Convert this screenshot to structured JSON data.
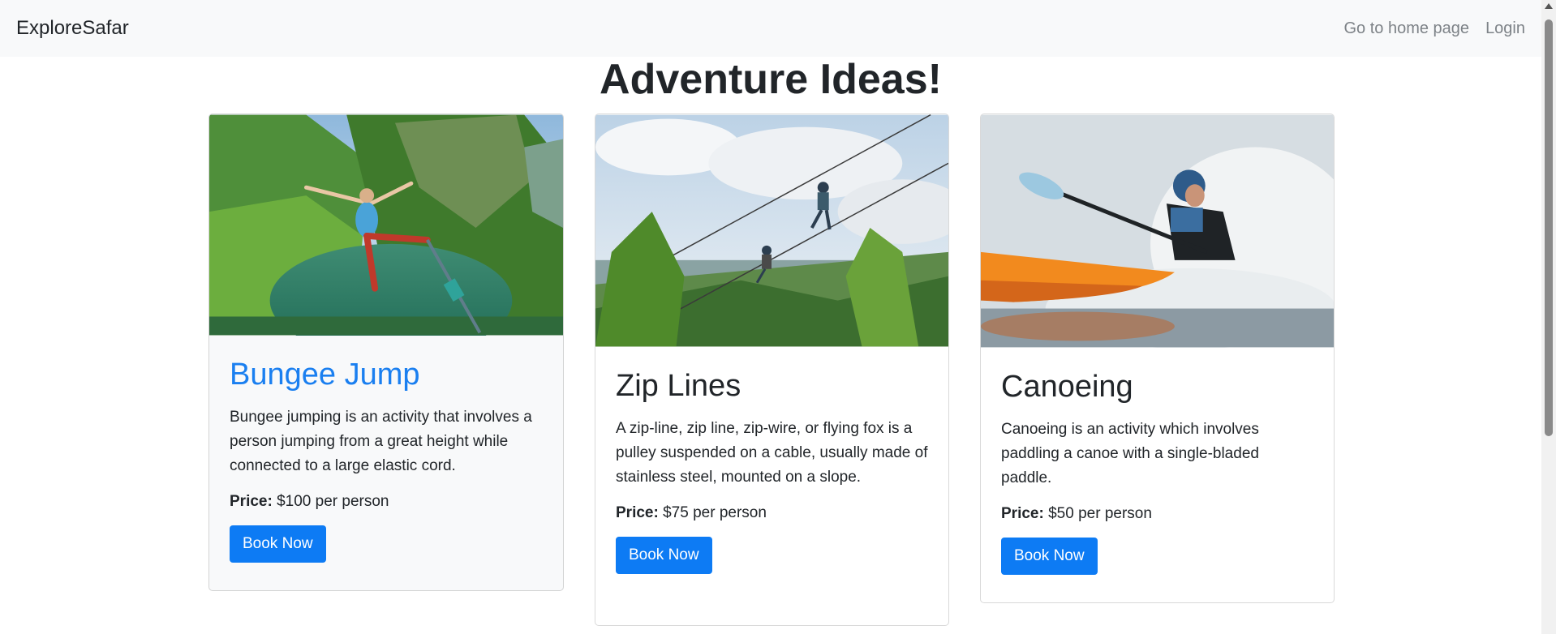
{
  "navbar": {
    "brand": "ExploreSafar",
    "links": [
      "Go to home page",
      "Login"
    ]
  },
  "page": {
    "title": "Adventure Ideas!"
  },
  "cards": [
    {
      "title": "Bungee Jump",
      "description": "Bungee jumping is an activity that involves a person jumping from a great height while connected to a large elastic cord.",
      "price_label": "Price:",
      "price_value": "$100 per person",
      "button": "Book Now",
      "image": "bungee-jump-photo"
    },
    {
      "title": "Zip Lines",
      "description": "A zip-line, zip line, zip-wire, or flying fox is a pulley suspended on a cable, usually made of stainless steel, mounted on a slope.",
      "price_label": "Price:",
      "price_value": "$75 per person",
      "button": "Book Now",
      "image": "zip-line-photo"
    },
    {
      "title": "Canoeing",
      "description": "Canoeing is an activity which involves paddling a canoe with a single-bladed paddle.",
      "price_label": "Price:",
      "price_value": "$50 per person",
      "button": "Book Now",
      "image": "canoeing-photo"
    }
  ],
  "colors": {
    "accent": "#0d7bf4",
    "active_title": "#1a7ff0",
    "navbar_bg": "#f8f9fa"
  }
}
